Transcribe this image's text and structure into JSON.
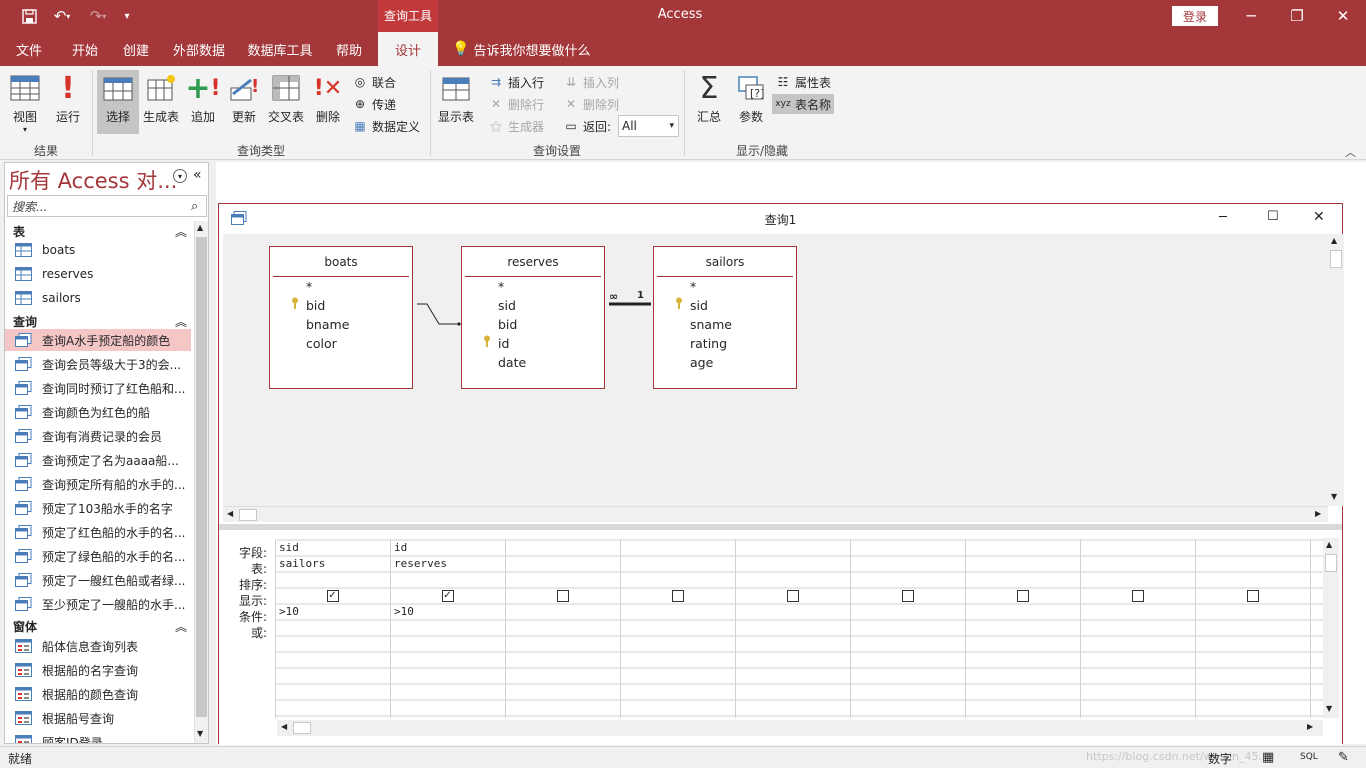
{
  "titlebar": {
    "context_tab": "查询工具",
    "app_title": "Access",
    "login": "登录"
  },
  "tabs": [
    "文件",
    "开始",
    "创建",
    "外部数据",
    "数据库工具",
    "帮助",
    "设计"
  ],
  "active_tab": "设计",
  "tellme": "告诉我你想要做什么",
  "ribbon": {
    "results": {
      "label": "结果",
      "view": "视图",
      "run": "运行"
    },
    "query_type": {
      "label": "查询类型",
      "select": "选择",
      "make_table": "生成表",
      "append": "追加",
      "update": "更新",
      "crosstab": "交叉表",
      "delete": "删除",
      "union": "联合",
      "passthrough": "传递",
      "data_definition": "数据定义"
    },
    "query_setup": {
      "label": "查询设置",
      "show_table": "显示表",
      "insert_rows": "插入行",
      "delete_rows": "删除行",
      "builder": "生成器",
      "insert_columns": "插入列",
      "delete_columns": "删除列",
      "return": "返回:",
      "return_value": "All"
    },
    "show_hide": {
      "label": "显示/隐藏",
      "totals": "汇总",
      "parameters": "参数",
      "property_sheet": "属性表",
      "table_names": "表名称"
    }
  },
  "nav": {
    "title": "所有 Access 对...",
    "search_placeholder": "搜索...",
    "sections": [
      {
        "title": "表",
        "items": [
          "boats",
          "reserves",
          "sailors"
        ]
      },
      {
        "title": "查询",
        "items": [
          "查询A水手预定船的颜色",
          "查询会员等级大于3的会...",
          "查询同时预订了红色船和...",
          "查询颜色为红色的船",
          "查询有消费记录的会员",
          "查询预定了名为aaaa船...",
          "查询预定所有船的水手的...",
          "预定了103船水手的名字",
          "预定了红色船的水手的名...",
          "预定了绿色船的水手的名...",
          "预定了一艘红色船或者绿...",
          "至少预定了一艘船的水手..."
        ]
      },
      {
        "title": "窗体",
        "items": [
          "船体信息查询列表",
          "根据船的名字查询",
          "根据船的颜色查询",
          "根据船号查询",
          "顾客ID登录"
        ]
      }
    ]
  },
  "query_window": {
    "title": "查询1",
    "tables": [
      {
        "name": "boats",
        "fields": [
          "*",
          "bid",
          "bname",
          "color"
        ],
        "key": "bid"
      },
      {
        "name": "reserves",
        "fields": [
          "*",
          "sid",
          "bid",
          "id",
          "date"
        ],
        "key": "id"
      },
      {
        "name": "sailors",
        "fields": [
          "*",
          "sid",
          "sname",
          "rating",
          "age"
        ],
        "key": "sid"
      }
    ],
    "relationship": {
      "many": "∞",
      "one": "1"
    },
    "grid": {
      "row_labels": [
        "字段:",
        "表:",
        "排序:",
        "显示:",
        "条件:",
        "或:"
      ],
      "columns": [
        {
          "field": "sid",
          "table": "sailors",
          "show": true,
          "criteria": ">10"
        },
        {
          "field": "id",
          "table": "reserves",
          "show": true,
          "criteria": ">10"
        },
        {
          "field": "",
          "table": "",
          "show": false,
          "criteria": ""
        },
        {
          "field": "",
          "table": "",
          "show": false,
          "criteria": ""
        },
        {
          "field": "",
          "table": "",
          "show": false,
          "criteria": ""
        },
        {
          "field": "",
          "table": "",
          "show": false,
          "criteria": ""
        },
        {
          "field": "",
          "table": "",
          "show": false,
          "criteria": ""
        },
        {
          "field": "",
          "table": "",
          "show": false,
          "criteria": ""
        },
        {
          "field": "",
          "table": "",
          "show": false,
          "criteria": ""
        }
      ]
    }
  },
  "status": {
    "left": "就绪",
    "mode": "数字",
    "sql": "SQL",
    "watermark": "https://blog.csdn.net/weixin_45..."
  },
  "colors": {
    "accent": "#a4373a",
    "ribbon_bg": "#f3f3f3",
    "selected_nav": "#f4c6c6"
  }
}
